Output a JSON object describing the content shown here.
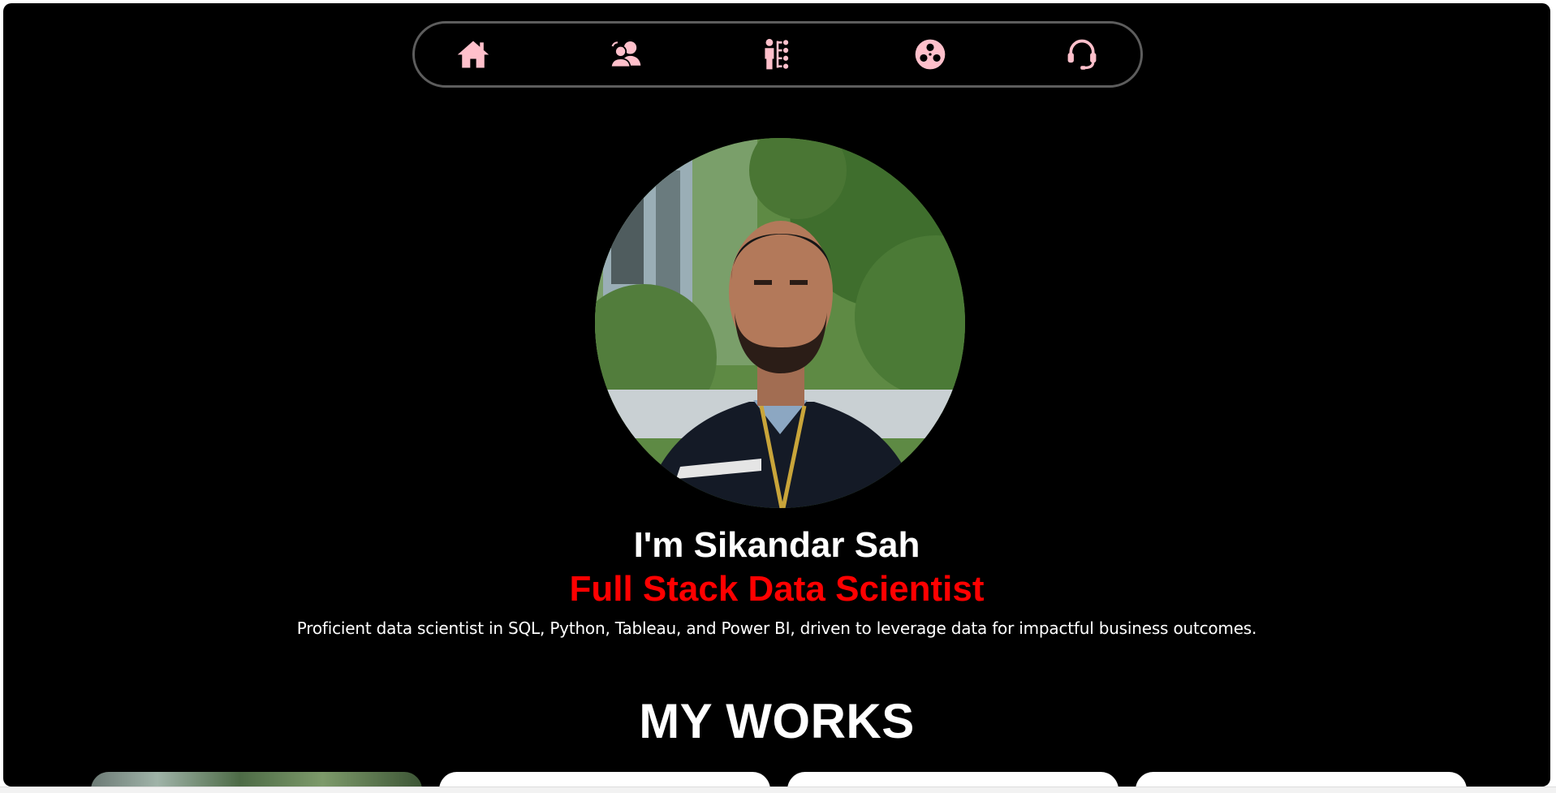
{
  "nav": {
    "items": [
      {
        "id": "home",
        "icon": "home-icon"
      },
      {
        "id": "about",
        "icon": "users-chat-icon"
      },
      {
        "id": "skills",
        "icon": "person-hierarchy-icon"
      },
      {
        "id": "projects",
        "icon": "film-reel-icon"
      },
      {
        "id": "contact",
        "icon": "headset-icon"
      }
    ],
    "icon_color": "#ffc0cb",
    "border_color": "#5d5d5d"
  },
  "profile": {
    "greeting": "I'm Sikandar Sah",
    "role": "Full Stack Data Scientist",
    "description": "Proficient data scientist in SQL, Python, Tableau, and Power BI, driven to leverage data for impactful business outcomes.",
    "role_color": "#ff0000"
  },
  "works": {
    "title": "MY WORKS"
  },
  "colors": {
    "background": "#000000",
    "text": "#ffffff"
  }
}
